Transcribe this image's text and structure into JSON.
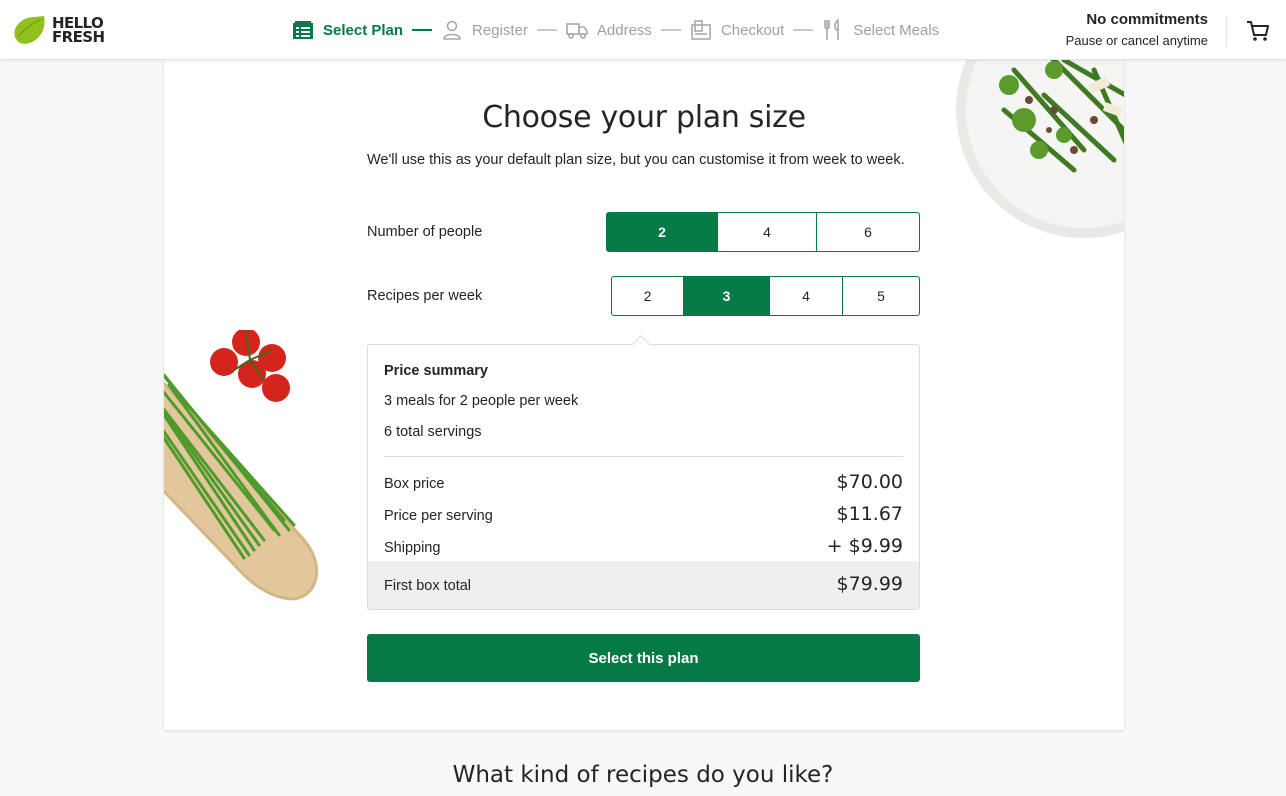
{
  "header": {
    "logo_line1": "HELLO",
    "logo_line2": "FRESH",
    "steps": [
      {
        "label": "Select Plan",
        "icon": "list-box-icon",
        "active": true
      },
      {
        "label": "Register",
        "icon": "user-icon",
        "active": false
      },
      {
        "label": "Address",
        "icon": "truck-icon",
        "active": false
      },
      {
        "label": "Checkout",
        "icon": "receipt-icon",
        "active": false
      },
      {
        "label": "Select Meals",
        "icon": "fork-knife-icon",
        "active": false
      }
    ],
    "commit_title": "No commitments",
    "commit_sub": "Pause or cancel anytime",
    "cart_icon": "cart-icon"
  },
  "plan": {
    "title": "Choose your plan size",
    "subtitle": "We'll use this as your default plan size, but you can customise it from week to week.",
    "people_label": "Number of people",
    "people_options": [
      "2",
      "4",
      "6"
    ],
    "people_selected": "2",
    "recipes_label": "Recipes per week",
    "recipes_options": [
      "2",
      "3",
      "4",
      "5"
    ],
    "recipes_selected": "3"
  },
  "summary": {
    "title": "Price summary",
    "meals_line": "3 meals for 2 people per week",
    "servings_line": "6 total servings",
    "box_price_label": "Box price",
    "box_price": "$70.00",
    "per_serving_label": "Price per serving",
    "per_serving": "$11.67",
    "shipping_label": "Shipping",
    "shipping": "+ $9.99",
    "total_label": "First box total",
    "total": "$79.99"
  },
  "cta_label": "Select this plan",
  "next_section_title": "What kind of recipes do you like?",
  "colors": {
    "brand_green": "#067a46",
    "logo_lime": "#91c11e"
  }
}
